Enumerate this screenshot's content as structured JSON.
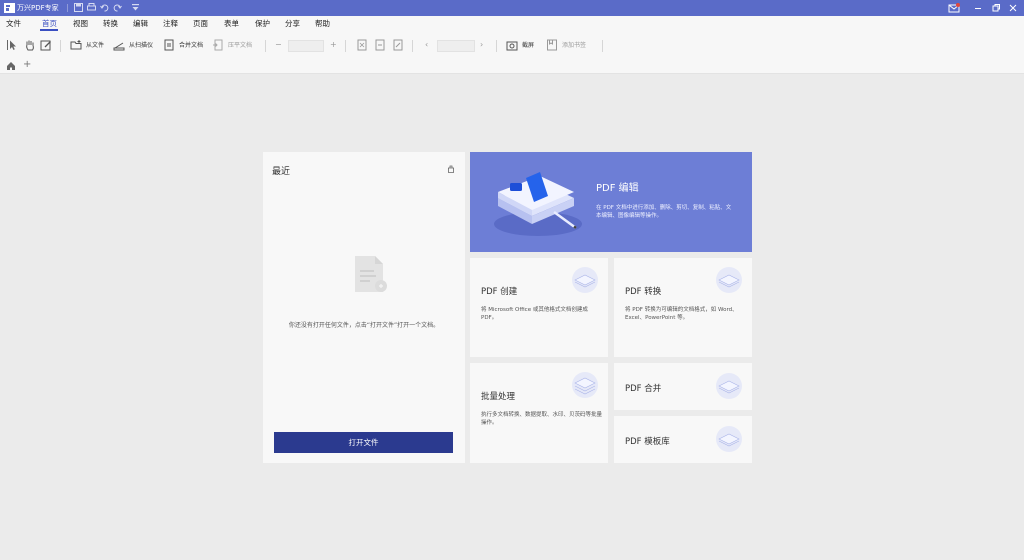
{
  "app": {
    "title": "万兴PDF专家"
  },
  "menu": {
    "file": "文件",
    "tabs": [
      "首页",
      "视图",
      "转换",
      "编辑",
      "注释",
      "页面",
      "表单",
      "保护",
      "分享",
      "帮助"
    ],
    "active_index": 0
  },
  "toolbar": {
    "from_file": "从文件",
    "from_scanner": "从扫描仪",
    "merge_docs": "合并文档",
    "compress_doc": "压平文档",
    "screenshot": "截屏",
    "add_bookmark": "添加书签"
  },
  "recent": {
    "title": "最近",
    "empty_text": "你还没有打开任何文件，点击“打开文件”打开一个文档。",
    "open_button": "打开文件"
  },
  "hero": {
    "title": "PDF 编辑",
    "desc": "在 PDF 文档中进行添加、删除、剪切、复制、粘贴、文本编辑、图像编辑等操作。"
  },
  "cards": {
    "create": {
      "title": "PDF 创建",
      "desc": "将 Microsoft Office 或其他格式文档创建成 PDF。"
    },
    "convert": {
      "title": "PDF 转换",
      "desc": "将 PDF 转换为可编辑的文档格式，如 Word、Excel、PowerPoint 等。"
    },
    "batch": {
      "title": "批量处理",
      "desc": "执行多文档转换、数据提取、水印、贝茨码等批量操作。"
    },
    "merge": {
      "title": "PDF 合并"
    },
    "template": {
      "title": "PDF 模板库"
    }
  },
  "colors": {
    "titlebar": "#5a6bc8",
    "accent": "#3a4fc1",
    "hero": "#6d7ed6",
    "button": "#2b3a8f"
  }
}
